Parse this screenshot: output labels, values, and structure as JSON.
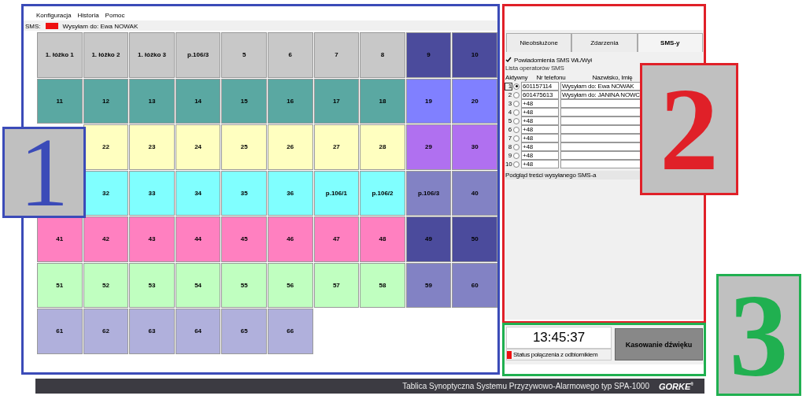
{
  "menu": [
    "Konfiguracja",
    "Historia",
    "Pomoc"
  ],
  "sms_status": {
    "label": "SMS:",
    "color": "#ee1111",
    "text": "Wysyłam do: Ewa NOWAK"
  },
  "grid": [
    {
      "kind": "room",
      "label": "1. łóżko 1",
      "color": "#c8c8c8"
    },
    {
      "kind": "room",
      "label": "1. łóżko 2",
      "color": "#c8c8c8"
    },
    {
      "kind": "room",
      "label": "1. łóżko 3",
      "color": "#c8c8c8"
    },
    {
      "kind": "room",
      "label": "p.106/3",
      "color": "#c8c8c8"
    },
    {
      "kind": "room",
      "label": "5",
      "color": "#c8c8c8"
    },
    {
      "kind": "room",
      "label": "6",
      "color": "#c8c8c8"
    },
    {
      "kind": "room",
      "label": "7",
      "color": "#c8c8c8"
    },
    {
      "kind": "room",
      "label": "8",
      "color": "#c8c8c8"
    },
    {
      "kind": "room",
      "label": "9",
      "color": "#4b4b9c"
    },
    {
      "kind": "room",
      "label": "10",
      "color": "#4b4b9c"
    },
    {
      "kind": "room",
      "label": "11",
      "color": "#5aa8a2"
    },
    {
      "kind": "room",
      "label": "12",
      "color": "#5aa8a2"
    },
    {
      "kind": "room",
      "label": "13",
      "color": "#5aa8a2"
    },
    {
      "kind": "room",
      "label": "14",
      "color": "#5aa8a2"
    },
    {
      "kind": "room",
      "label": "15",
      "color": "#5aa8a2"
    },
    {
      "kind": "room",
      "label": "16",
      "color": "#5aa8a2"
    },
    {
      "kind": "room",
      "label": "17",
      "color": "#5aa8a2"
    },
    {
      "kind": "room",
      "label": "18",
      "color": "#5aa8a2"
    },
    {
      "kind": "room",
      "label": "19",
      "color": "#8080ff"
    },
    {
      "kind": "room",
      "label": "20",
      "color": "#8080ff"
    },
    {
      "kind": "covered"
    },
    {
      "kind": "room",
      "label": "22",
      "color": "#ffffc0"
    },
    {
      "kind": "room",
      "label": "23",
      "color": "#ffffc0"
    },
    {
      "kind": "room",
      "label": "24",
      "color": "#ffffc0"
    },
    {
      "kind": "room",
      "label": "25",
      "color": "#ffffc0"
    },
    {
      "kind": "room",
      "label": "26",
      "color": "#ffffc0"
    },
    {
      "kind": "room",
      "label": "27",
      "color": "#ffffc0"
    },
    {
      "kind": "room",
      "label": "28",
      "color": "#ffffc0"
    },
    {
      "kind": "room",
      "label": "29",
      "color": "#b070f0"
    },
    {
      "kind": "room",
      "label": "30",
      "color": "#b070f0"
    },
    {
      "kind": "covered"
    },
    {
      "kind": "room",
      "label": "32",
      "color": "#80ffff"
    },
    {
      "kind": "room",
      "label": "33",
      "color": "#80ffff"
    },
    {
      "kind": "room",
      "label": "34",
      "color": "#80ffff"
    },
    {
      "kind": "room",
      "label": "35",
      "color": "#80ffff"
    },
    {
      "kind": "room",
      "label": "36",
      "color": "#80ffff"
    },
    {
      "kind": "room",
      "label": "p.106/1",
      "color": "#80ffff"
    },
    {
      "kind": "room",
      "label": "p.106/2",
      "color": "#80ffff"
    },
    {
      "kind": "room",
      "label": "p.106/3",
      "color": "#8282c4"
    },
    {
      "kind": "room",
      "label": "40",
      "color": "#8282c4"
    },
    {
      "kind": "room",
      "label": "41",
      "color": "#ff80c0"
    },
    {
      "kind": "room",
      "label": "42",
      "color": "#ff80c0"
    },
    {
      "kind": "room",
      "label": "43",
      "color": "#ff80c0"
    },
    {
      "kind": "room",
      "label": "44",
      "color": "#ff80c0"
    },
    {
      "kind": "room",
      "label": "45",
      "color": "#ff80c0"
    },
    {
      "kind": "room",
      "label": "46",
      "color": "#ff80c0"
    },
    {
      "kind": "room",
      "label": "47",
      "color": "#ff80c0"
    },
    {
      "kind": "room",
      "label": "48",
      "color": "#ff80c0"
    },
    {
      "kind": "room",
      "label": "49",
      "color": "#4b4b9c"
    },
    {
      "kind": "room",
      "label": "50",
      "color": "#4b4b9c"
    },
    {
      "kind": "room",
      "label": "51",
      "color": "#c0ffc0"
    },
    {
      "kind": "room",
      "label": "52",
      "color": "#c0ffc0"
    },
    {
      "kind": "room",
      "label": "53",
      "color": "#c0ffc0"
    },
    {
      "kind": "room",
      "label": "54",
      "color": "#c0ffc0"
    },
    {
      "kind": "room",
      "label": "55",
      "color": "#c0ffc0"
    },
    {
      "kind": "room",
      "label": "56",
      "color": "#c0ffc0"
    },
    {
      "kind": "room",
      "label": "57",
      "color": "#c0ffc0"
    },
    {
      "kind": "room",
      "label": "58",
      "color": "#c0ffc0"
    },
    {
      "kind": "room",
      "label": "59",
      "color": "#8282c4"
    },
    {
      "kind": "room",
      "label": "60",
      "color": "#8282c4"
    },
    {
      "kind": "room",
      "label": "61",
      "color": "#b0b0dc"
    },
    {
      "kind": "room",
      "label": "62",
      "color": "#b0b0dc"
    },
    {
      "kind": "room",
      "label": "63",
      "color": "#b0b0dc"
    },
    {
      "kind": "room",
      "label": "64",
      "color": "#b0b0dc"
    },
    {
      "kind": "room",
      "label": "65",
      "color": "#b0b0dc"
    },
    {
      "kind": "room",
      "label": "66",
      "color": "#b0b0dc"
    }
  ],
  "tabs": [
    {
      "label": "Nieobsłużone",
      "selected": false
    },
    {
      "label": "Zdarzenia",
      "selected": false
    },
    {
      "label": "SMS-y",
      "selected": true
    }
  ],
  "sms_toggle": {
    "label": "Powiadomienia SMS WŁ/Wył",
    "checked": true
  },
  "operators": {
    "title": "Lista operatorów SMS",
    "columns": [
      "Aktywny",
      "Nr telefonu",
      "Nazwisko, Imię"
    ],
    "rows": [
      {
        "num": "1",
        "selected": true,
        "phone": "601157114",
        "name": "Wysyłam do: Ewa NOWAK"
      },
      {
        "num": "2",
        "selected": false,
        "phone": "601475613",
        "name": "Wysyłam do: JANINA NOWC"
      },
      {
        "num": "3",
        "selected": false,
        "phone": "+48"
      },
      {
        "num": "4",
        "selected": false,
        "phone": "+48"
      },
      {
        "num": "5",
        "selected": false,
        "phone": "+48"
      },
      {
        "num": "6",
        "selected": false,
        "phone": "+48"
      },
      {
        "num": "7",
        "selected": false,
        "phone": "+48"
      },
      {
        "num": "8",
        "selected": false,
        "phone": "+48"
      },
      {
        "num": "9",
        "selected": false,
        "phone": "+48"
      },
      {
        "num": "10",
        "selected": false,
        "phone": "+48"
      }
    ]
  },
  "preview_label": "Podgląd treści wysyłanego SMS-a",
  "clock": "13:45:37",
  "connection": {
    "label": "Status połączenia z odbiornikiem",
    "color": "#ee1111"
  },
  "mute_button": "Kasowanie dźwięku",
  "footer": {
    "title": "Tablica Synoptyczna Systemu Przyzywowo-Alarmowego typ SPA-1000",
    "logo": "GORKE",
    "logo_mark": "®"
  },
  "annotations": [
    {
      "number": "1",
      "color": "#3b4bb8"
    },
    {
      "number": "2",
      "color": "#e02028"
    },
    {
      "number": "3",
      "color": "#20b050"
    }
  ]
}
